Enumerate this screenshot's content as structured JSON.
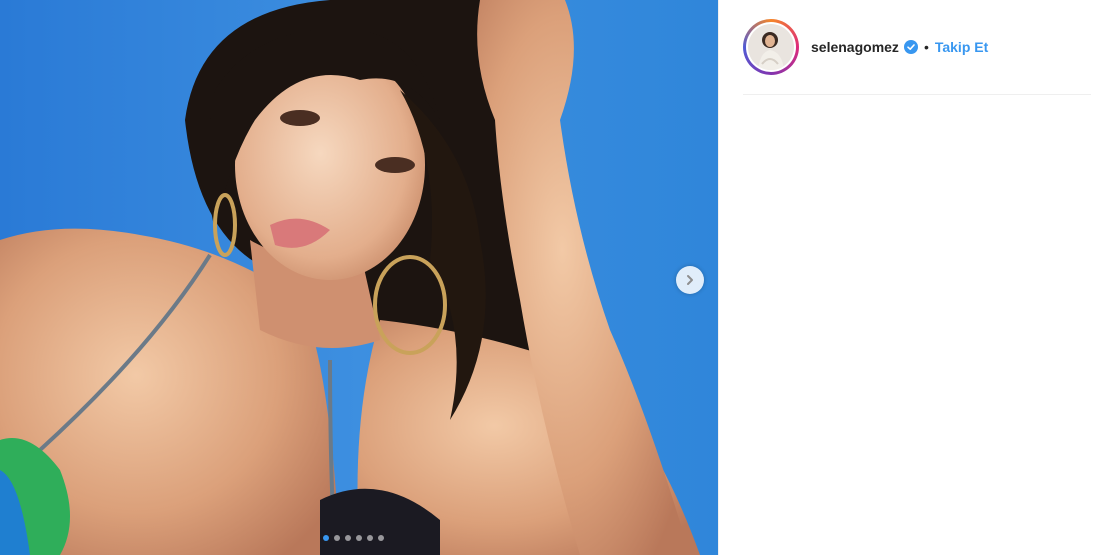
{
  "post": {
    "image": {
      "subject": "woman-selfie-sky-background",
      "slide_count": 6,
      "active_slide": 1
    },
    "next_icon": "chevron-right-icon"
  },
  "header": {
    "username": "selenagomez",
    "verified": true,
    "verified_icon": "verified-badge-icon",
    "separator": "•",
    "follow_label": "Takip Et"
  },
  "colors": {
    "accent": "#3897f0",
    "text": "#262626",
    "divider": "#efefef"
  }
}
